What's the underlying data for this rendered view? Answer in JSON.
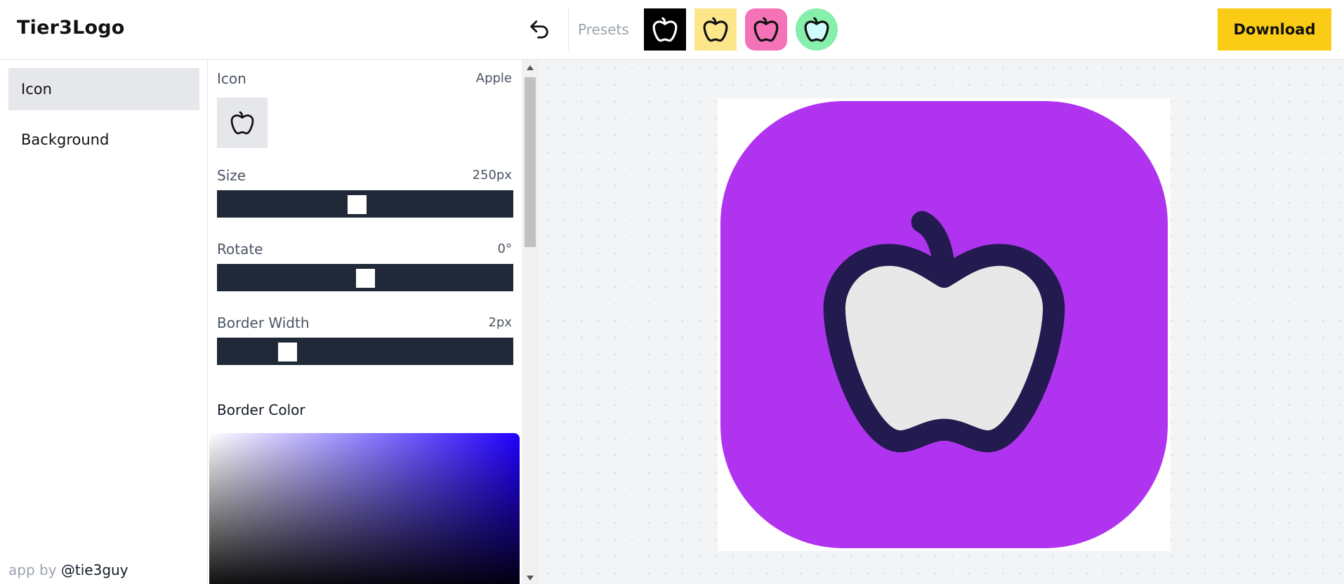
{
  "header": {
    "app_title": "Tier3Logo",
    "presets_label": "Presets",
    "download_label": "Download",
    "presets": [
      {
        "name": "black",
        "bg": "#000000",
        "stroke": "#ffffff",
        "fill": "#000000"
      },
      {
        "name": "yellow",
        "bg": "#fde68a",
        "stroke": "#111111",
        "fill": "#fde68a"
      },
      {
        "name": "pink",
        "bg": "#f472b6",
        "stroke": "#111111",
        "fill": "#f472b6"
      },
      {
        "name": "green",
        "bg": "#86efac",
        "stroke": "#111111",
        "fill": "#cffafe"
      }
    ]
  },
  "sidebar": {
    "items": [
      {
        "label": "Icon",
        "active": true
      },
      {
        "label": "Background",
        "active": false
      }
    ],
    "credit_prefix": "app by",
    "credit_handle": "@tie3guy"
  },
  "panel": {
    "icon_label": "Icon",
    "icon_value": "Apple",
    "size": {
      "label": "Size",
      "value": "250px",
      "level": 0.47
    },
    "rotate": {
      "label": "Rotate",
      "value": "0°",
      "level": 0.5
    },
    "border_width": {
      "label": "Border Width",
      "value": "2px",
      "level": 0.22
    },
    "border_color_label": "Border Color",
    "picker_hue": "#2200ff"
  },
  "canvas": {
    "background_color": "#b033ef",
    "icon_name": "apple-icon",
    "icon_stroke": "#231a4f",
    "icon_fill": "#e8e8e8"
  }
}
